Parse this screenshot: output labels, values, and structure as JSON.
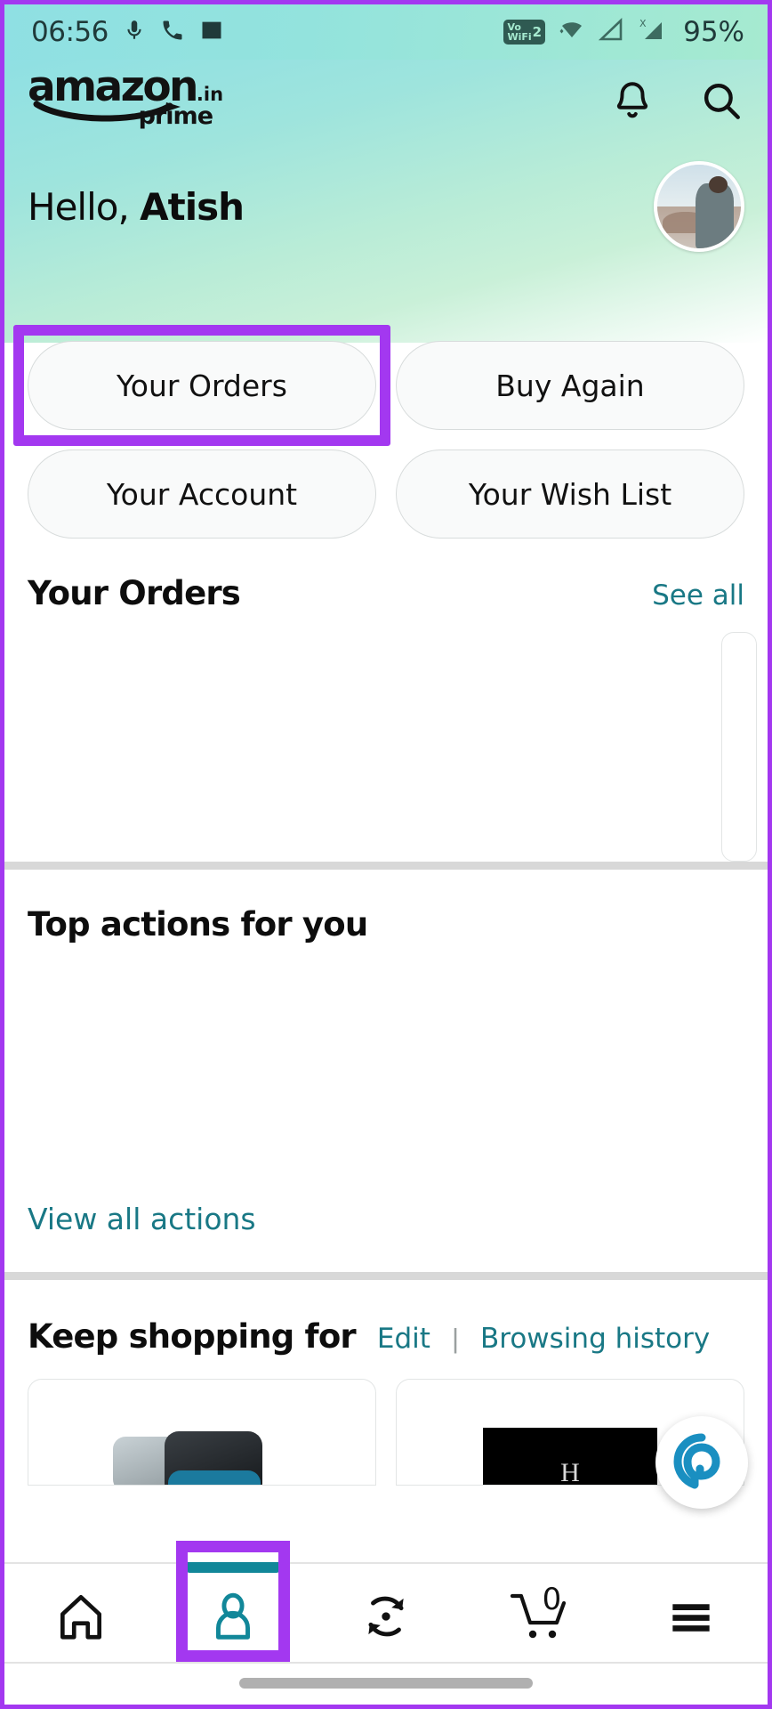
{
  "status_bar": {
    "time": "06:56",
    "icons_left": [
      "microphone-icon",
      "phone-call-icon",
      "image-icon"
    ],
    "network_badge": "VoWiFi2",
    "vowifi_line1": "Vo",
    "vowifi_line2": "WiFi",
    "vowifi_num": "2",
    "icons_right": [
      "wifi-icon",
      "signal-empty-icon",
      "signal-x-icon"
    ],
    "battery": "95%"
  },
  "app_header": {
    "logo_word": "amazon",
    "logo_tld": ".in",
    "logo_sub": "prime",
    "bell_icon": "notification-bell-icon",
    "search_icon": "search-icon",
    "greeting_prefix": "Hello, ",
    "greeting_name": "Atish",
    "avatar_name": "user-avatar"
  },
  "quick_actions": [
    {
      "label": "Your Orders",
      "highlighted": true
    },
    {
      "label": "Buy Again",
      "highlighted": false
    },
    {
      "label": "Your Account",
      "highlighted": false
    },
    {
      "label": "Your Wish List",
      "highlighted": false
    }
  ],
  "orders_section": {
    "title": "Your Orders",
    "see_all": "See all"
  },
  "top_actions_section": {
    "title": "Top actions for you",
    "view_all": "View all actions"
  },
  "keep_shopping_section": {
    "title": "Keep shopping for",
    "edit": "Edit",
    "separator": "|",
    "browsing_history": "Browsing history",
    "products": [
      {
        "name": "smartphone-product-card",
        "caption": ""
      },
      {
        "name": "black-product-card",
        "caption": "H"
      }
    ]
  },
  "floating_button": {
    "name": "alexa-assistant-button",
    "accent": "#1a8fc1"
  },
  "bottom_nav": {
    "items": [
      {
        "name": "nav-home",
        "icon": "home-icon",
        "active": false
      },
      {
        "name": "nav-profile",
        "icon": "person-icon",
        "active": true,
        "highlighted": true
      },
      {
        "name": "nav-refresh",
        "icon": "sync-icon",
        "active": false
      },
      {
        "name": "nav-cart",
        "icon": "shopping-cart-icon",
        "active": false,
        "badge": "0"
      },
      {
        "name": "nav-menu",
        "icon": "hamburger-menu-icon",
        "active": false
      }
    ]
  },
  "colors": {
    "highlight": "#A338F0",
    "accent_teal": "#197885",
    "active_nav": "#118799",
    "header_gradient_start": "#8fe0e3",
    "header_gradient_end": "#c9f0d8"
  }
}
